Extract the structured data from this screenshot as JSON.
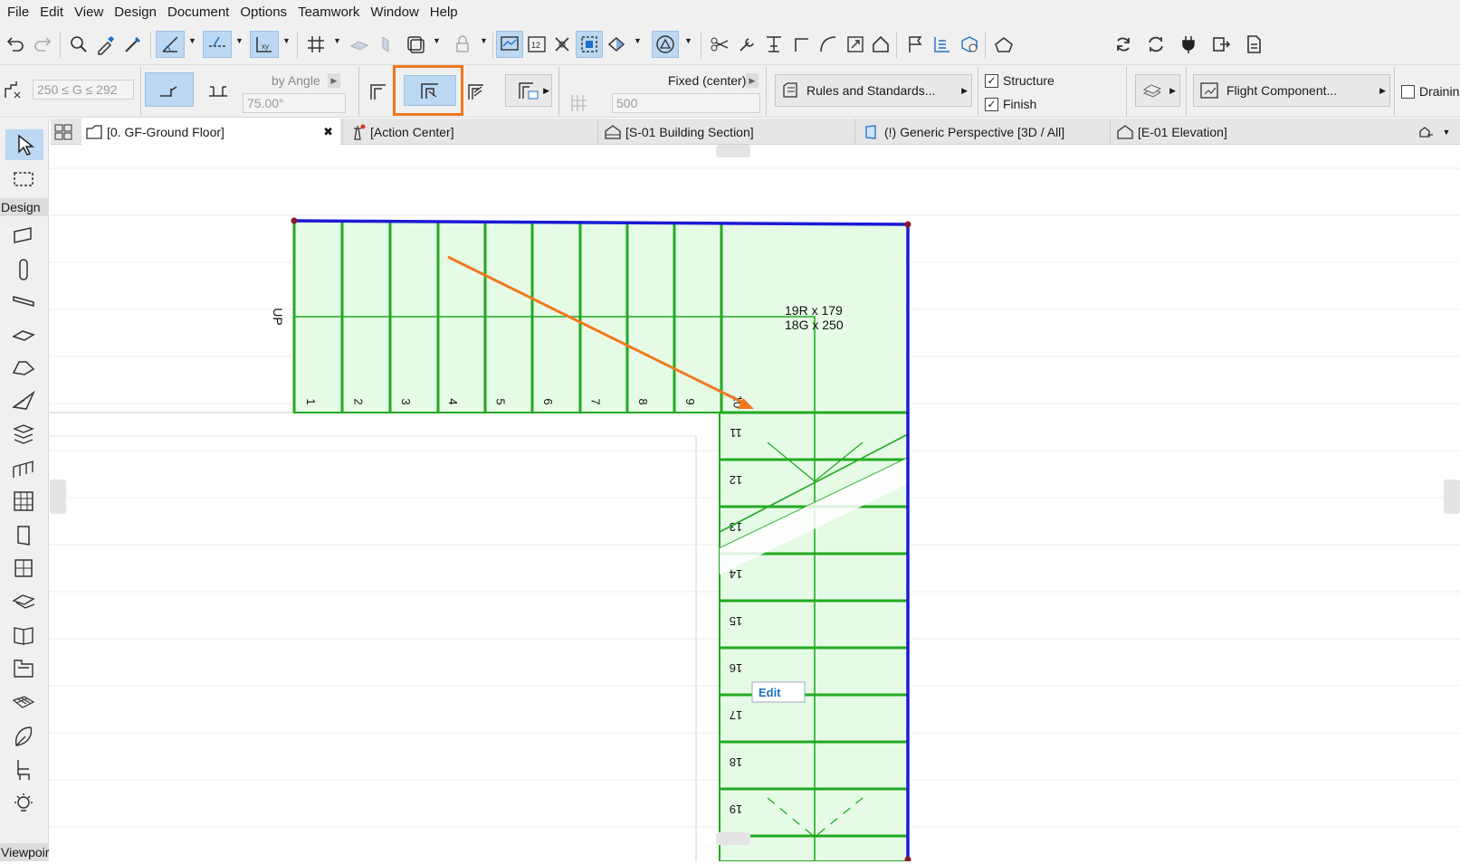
{
  "menu": [
    "File",
    "Edit",
    "View",
    "Design",
    "Document",
    "Options",
    "Teamwork",
    "Window",
    "Help"
  ],
  "toolbar": {
    "icons": [
      "undo-icon",
      "redo-icon",
      "find-select-icon",
      "eyedropper-icon",
      "syringe-icon",
      "guide-lines-icon",
      "snap-guides-icon",
      "coordinate-icon",
      "grid-snap-icon",
      "suspend-groups-icon",
      "selection-highlight-icon",
      "layer-icon",
      "lock-icon",
      "trace-reference-icon",
      "numbering-icon",
      "cross-icon",
      "magic-wand-icon",
      "renovation-icon",
      "attribute-icon",
      "split-icon",
      "adjust-icon",
      "elevate-icon",
      "corner-icon",
      "fillet-icon",
      "resize-icon",
      "house-icon",
      "flag-icon",
      "schedule-icon",
      "3d-window-icon",
      "roof-icon",
      "refresh-icon",
      "send-receive-icon",
      "plugin-icon",
      "publish-icon",
      "document-icon"
    ]
  },
  "infobox": {
    "going_field": "250 ≤ G ≤ 292",
    "by_angle_label": "by Angle",
    "angle_field": "75.00°",
    "fixed_label": "Fixed (center)",
    "width_field": "500",
    "rules_button": "Rules and Standards...",
    "structure_label": "Structure",
    "finish_label": "Finish",
    "flight_button": "Flight Component...",
    "draining_label": "Drainin",
    "structure_checked": true,
    "finish_checked": true,
    "draining_checked": false
  },
  "tabs": [
    {
      "label": "[0. GF-Ground Floor]",
      "close": "✖"
    },
    {
      "label": "[Action Center]"
    },
    {
      "label": "[S-01 Building Section]"
    },
    {
      "label": "(!) Generic Perspective [3D / All]"
    },
    {
      "label": "[E-01 Elevation]"
    }
  ],
  "toolbox": {
    "design_header": "Design",
    "viewpoint_header": "Viewpoir"
  },
  "plan": {
    "up_label": "UP",
    "riser_text": "19R x 179",
    "going_text": "18G x 250",
    "step_numbers": [
      "1",
      "2",
      "3",
      "4",
      "5",
      "6",
      "7",
      "8",
      "9",
      "10",
      "11",
      "12",
      "13",
      "14",
      "15",
      "16",
      "17",
      "18",
      "19"
    ],
    "edit_label": "Edit",
    "colors": {
      "stair_fill": "#e6fbe6",
      "stair_line": "#22aa22",
      "boundary": "#1a1ad6",
      "arrow": "#f07820"
    }
  }
}
